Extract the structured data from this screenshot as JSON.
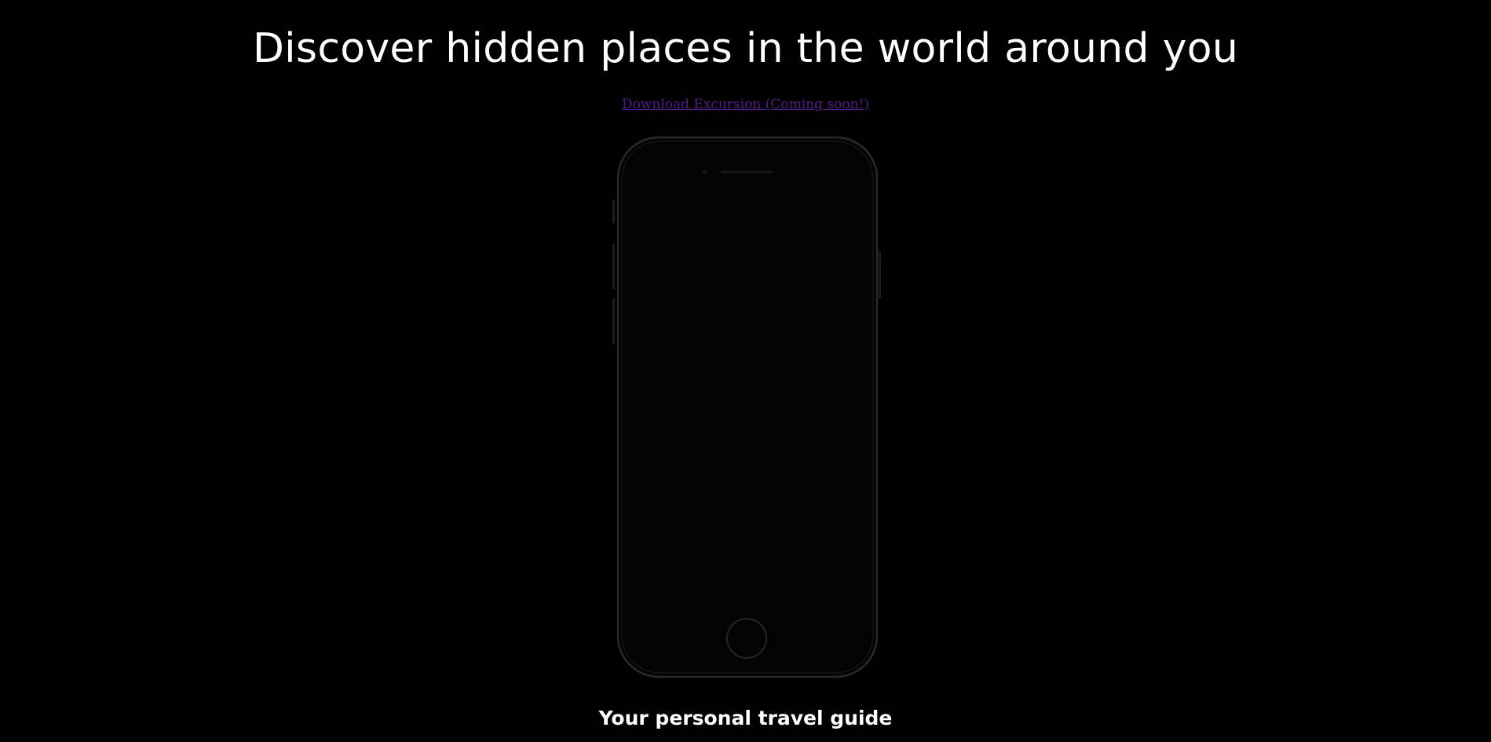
{
  "hero": {
    "headline": "Discover hidden places in the world around you",
    "download_link": "Download Excursion (Coming soon!)"
  },
  "device": {
    "icon": "smartphone-icon",
    "frame_color": "#2a2a2a",
    "screen_color": "#000000"
  },
  "section": {
    "tagline": "Your personal travel guide"
  },
  "colors": {
    "background": "#000000",
    "text": "#ffffff",
    "visited_link": "#551a8b"
  }
}
